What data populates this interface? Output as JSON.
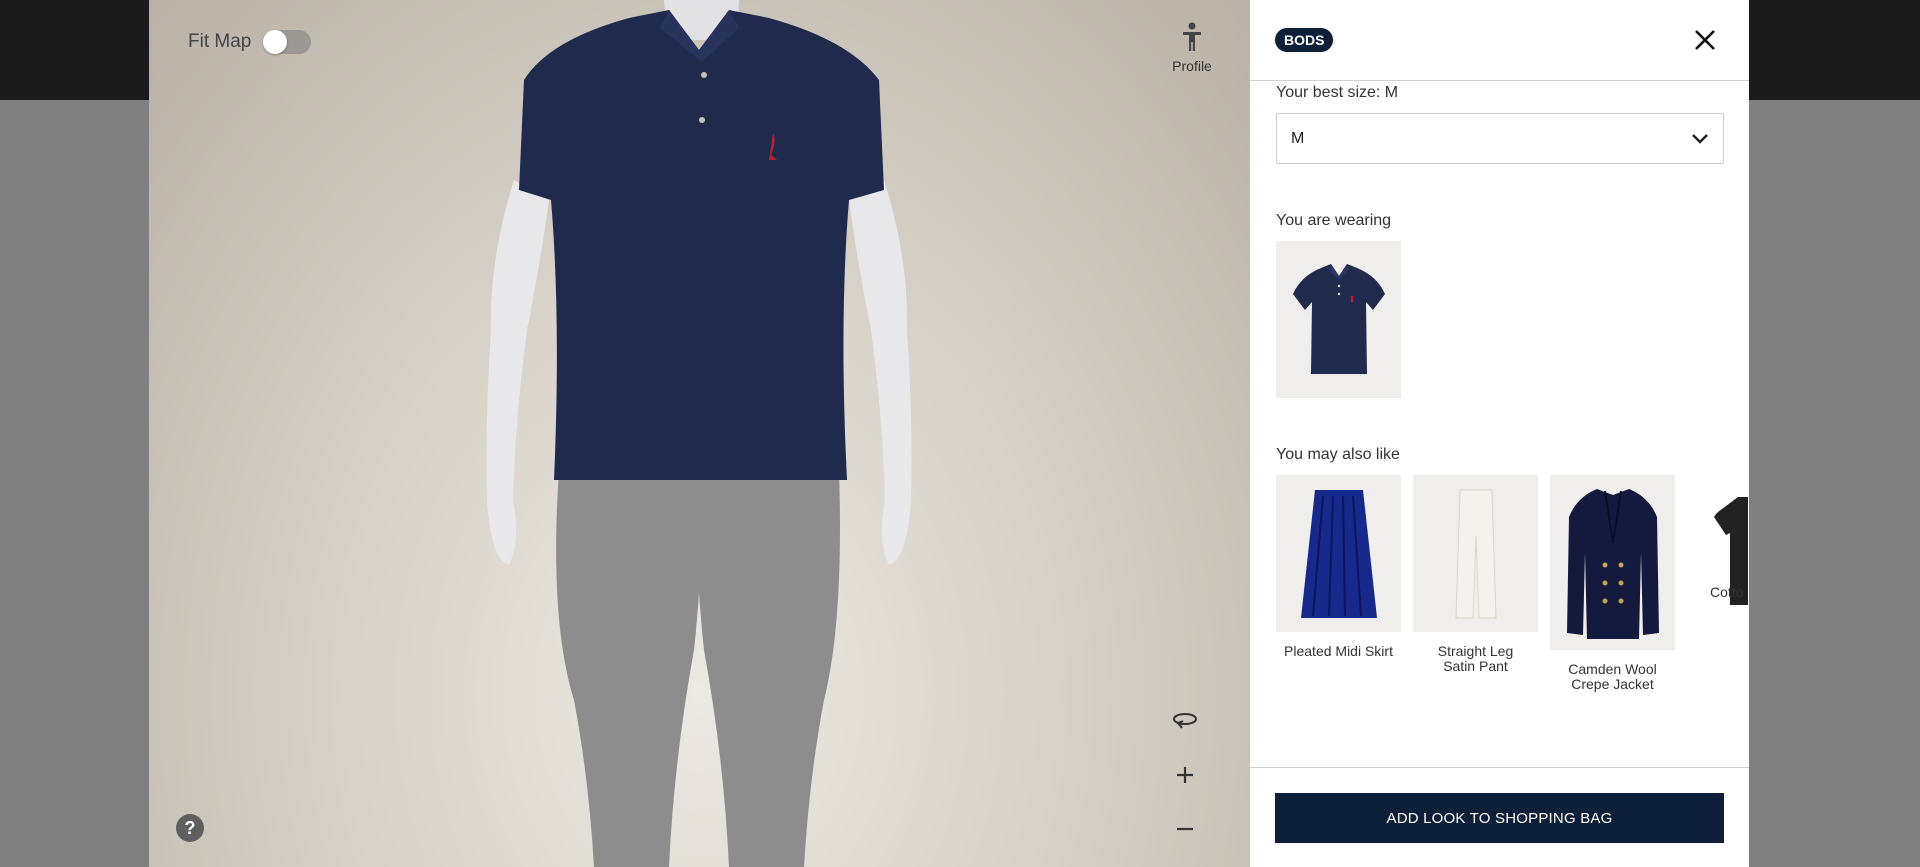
{
  "viewer": {
    "fit_map_label": "Fit Map",
    "fit_map_on": false,
    "profile_label": "Profile",
    "help_label": "?",
    "controls": [
      "rotate-icon",
      "zoom-in-icon",
      "zoom-out-icon"
    ]
  },
  "panel": {
    "logo_text": "BODS",
    "best_size_label": "Your best size: M",
    "size_select": {
      "selected": "M"
    },
    "wearing_title": "You are wearing",
    "wearing_item": "polo-shirt-navy",
    "also_like_title": "You may also like",
    "recommendations": [
      {
        "name_line1": "Pleated Midi Skirt",
        "name_line2": ""
      },
      {
        "name_line1": "Straight Leg",
        "name_line2": "Satin Pant"
      },
      {
        "name_line1": "Camden Wool",
        "name_line2": "Crepe Jacket"
      },
      {
        "name_line1": "Cotto",
        "name_line2": ""
      }
    ],
    "add_button_label": "ADD LOOK TO SHOPPING BAG"
  },
  "colors": {
    "brand_navy": "#0e1f3a",
    "viewer_bg": "#d8d2c8",
    "panel_bg": "#ffffff"
  }
}
